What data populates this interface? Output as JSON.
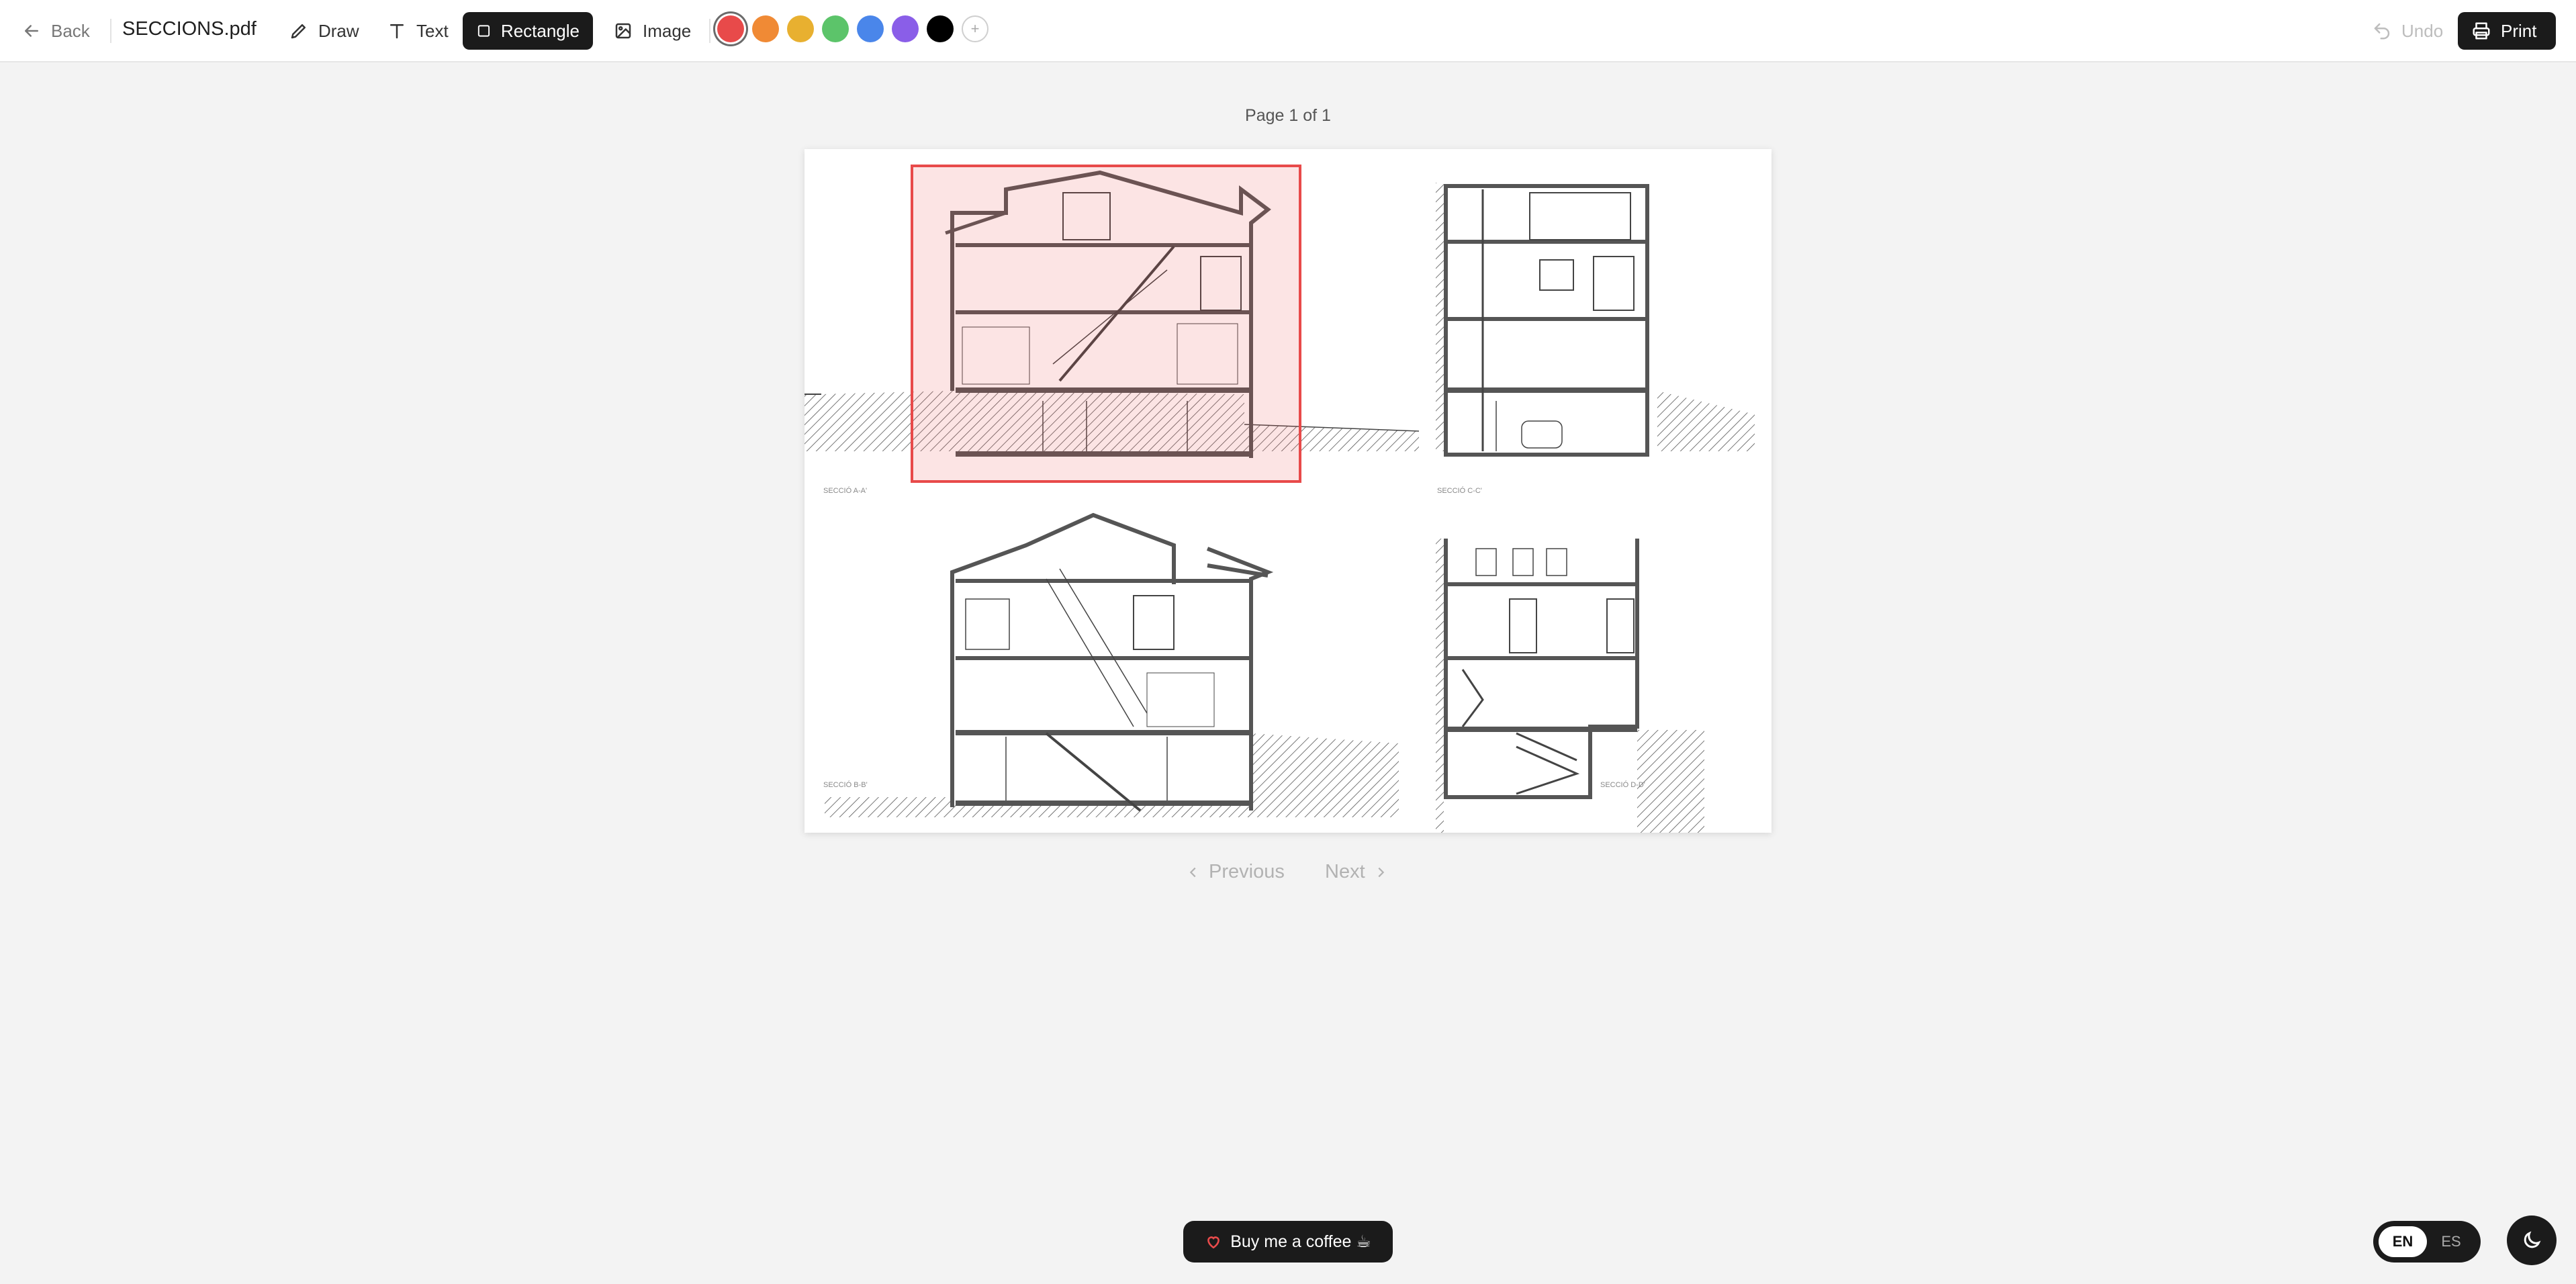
{
  "toolbar": {
    "back_label": "Back",
    "file_name": "SECCIONS.pdf",
    "tools": {
      "draw": "Draw",
      "text": "Text",
      "rectangle": "Rectangle",
      "image": "Image"
    },
    "active_tool": "rectangle",
    "colors": [
      "#e84a4a",
      "#f08a35",
      "#e8b030",
      "#5cc46a",
      "#4a86ea",
      "#8a5ee8",
      "#000000"
    ],
    "active_color": "#e84a4a",
    "add_color_symbol": "+",
    "undo_label": "Undo",
    "print_label": "Print"
  },
  "viewer": {
    "page_counter": "Page 1 of 1",
    "prev_label": "Previous",
    "next_label": "Next",
    "drawing_labels": [
      "SECCIÓ A-A'",
      "SECCIÓ C-C'",
      "SECCIÓ B-B'",
      "SECCIÓ D-D'"
    ],
    "annotation_color": "#e84a4a"
  },
  "footer": {
    "coffee_label": "Buy me a coffee ☕",
    "languages": [
      "EN",
      "ES"
    ],
    "active_language": "EN"
  },
  "icons": {
    "back": "arrow-left-icon",
    "draw": "pencil-icon",
    "text": "text-icon",
    "rectangle": "square-icon",
    "image": "image-icon",
    "undo": "undo-icon",
    "print": "printer-icon",
    "coffee": "heart-icon",
    "theme": "moon-icon"
  }
}
